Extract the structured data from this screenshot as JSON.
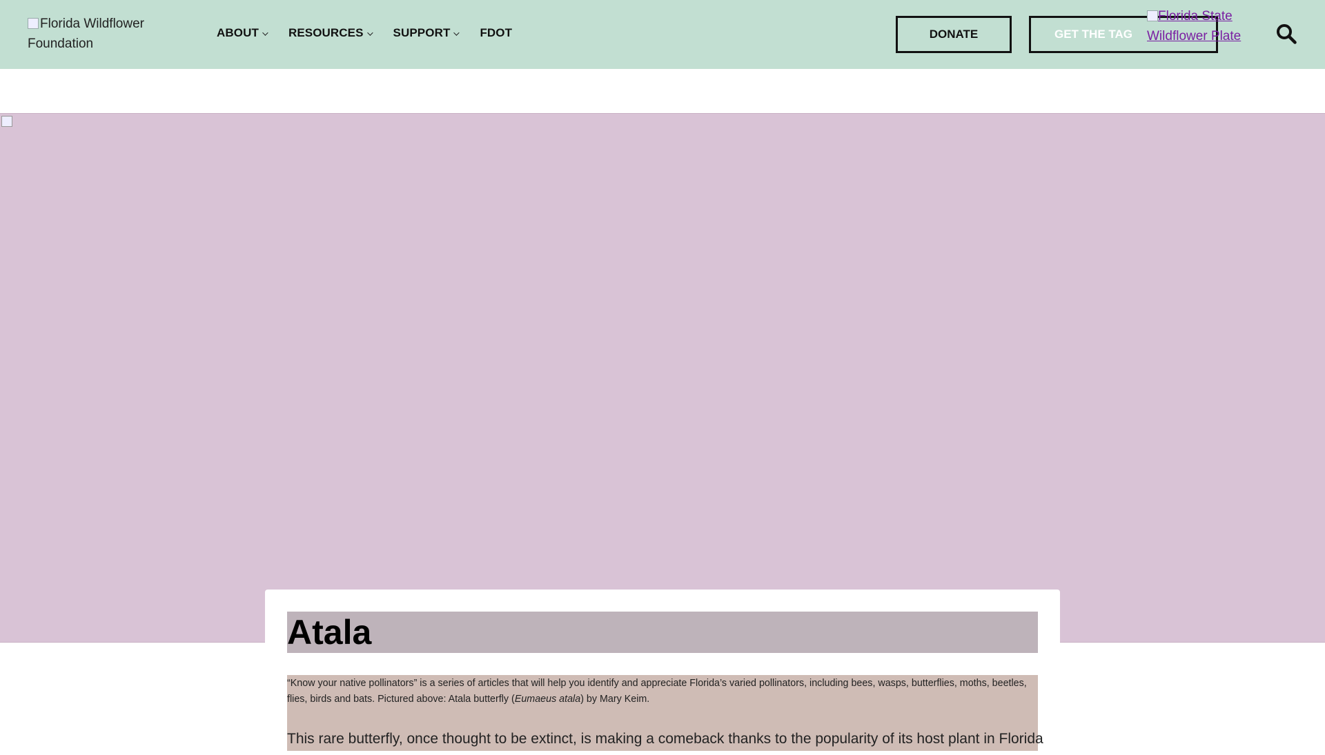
{
  "header": {
    "logo_alt": "Florida Wildflower Foundation",
    "nav": [
      {
        "label": "ABOUT",
        "has_dropdown": true
      },
      {
        "label": "RESOURCES",
        "has_dropdown": true
      },
      {
        "label": "SUPPORT",
        "has_dropdown": true
      },
      {
        "label": "FDOT",
        "has_dropdown": false
      }
    ],
    "donate_label": "DONATE",
    "tag_label": "GET THE TAG",
    "plate_alt": "Florida State Wildflower Plate",
    "search_icon": "search-icon"
  },
  "article": {
    "title": "Atala",
    "caption_before": "“Know your native pollinators” is a series of articles that will help you identify and appreciate Florida’s varied pollinators, including bees, wasps, butterflies, moths, beetles, flies, birds and bats. Pictured above: Atala butterfly (",
    "caption_italic": "Eumaeus atala",
    "caption_after": ") by Mary Keim.",
    "intro": "This rare butterfly, once thought to be extinct, is making a comeback thanks to the popularity of its host plant in Florida"
  },
  "colors": {
    "header_bg": "#c2dfd2",
    "hero_bg": "#d9c3d6",
    "title_highlight": "#beb3ba",
    "caption_highlight": "#cfbcb5",
    "link": "#7a1fa2"
  }
}
